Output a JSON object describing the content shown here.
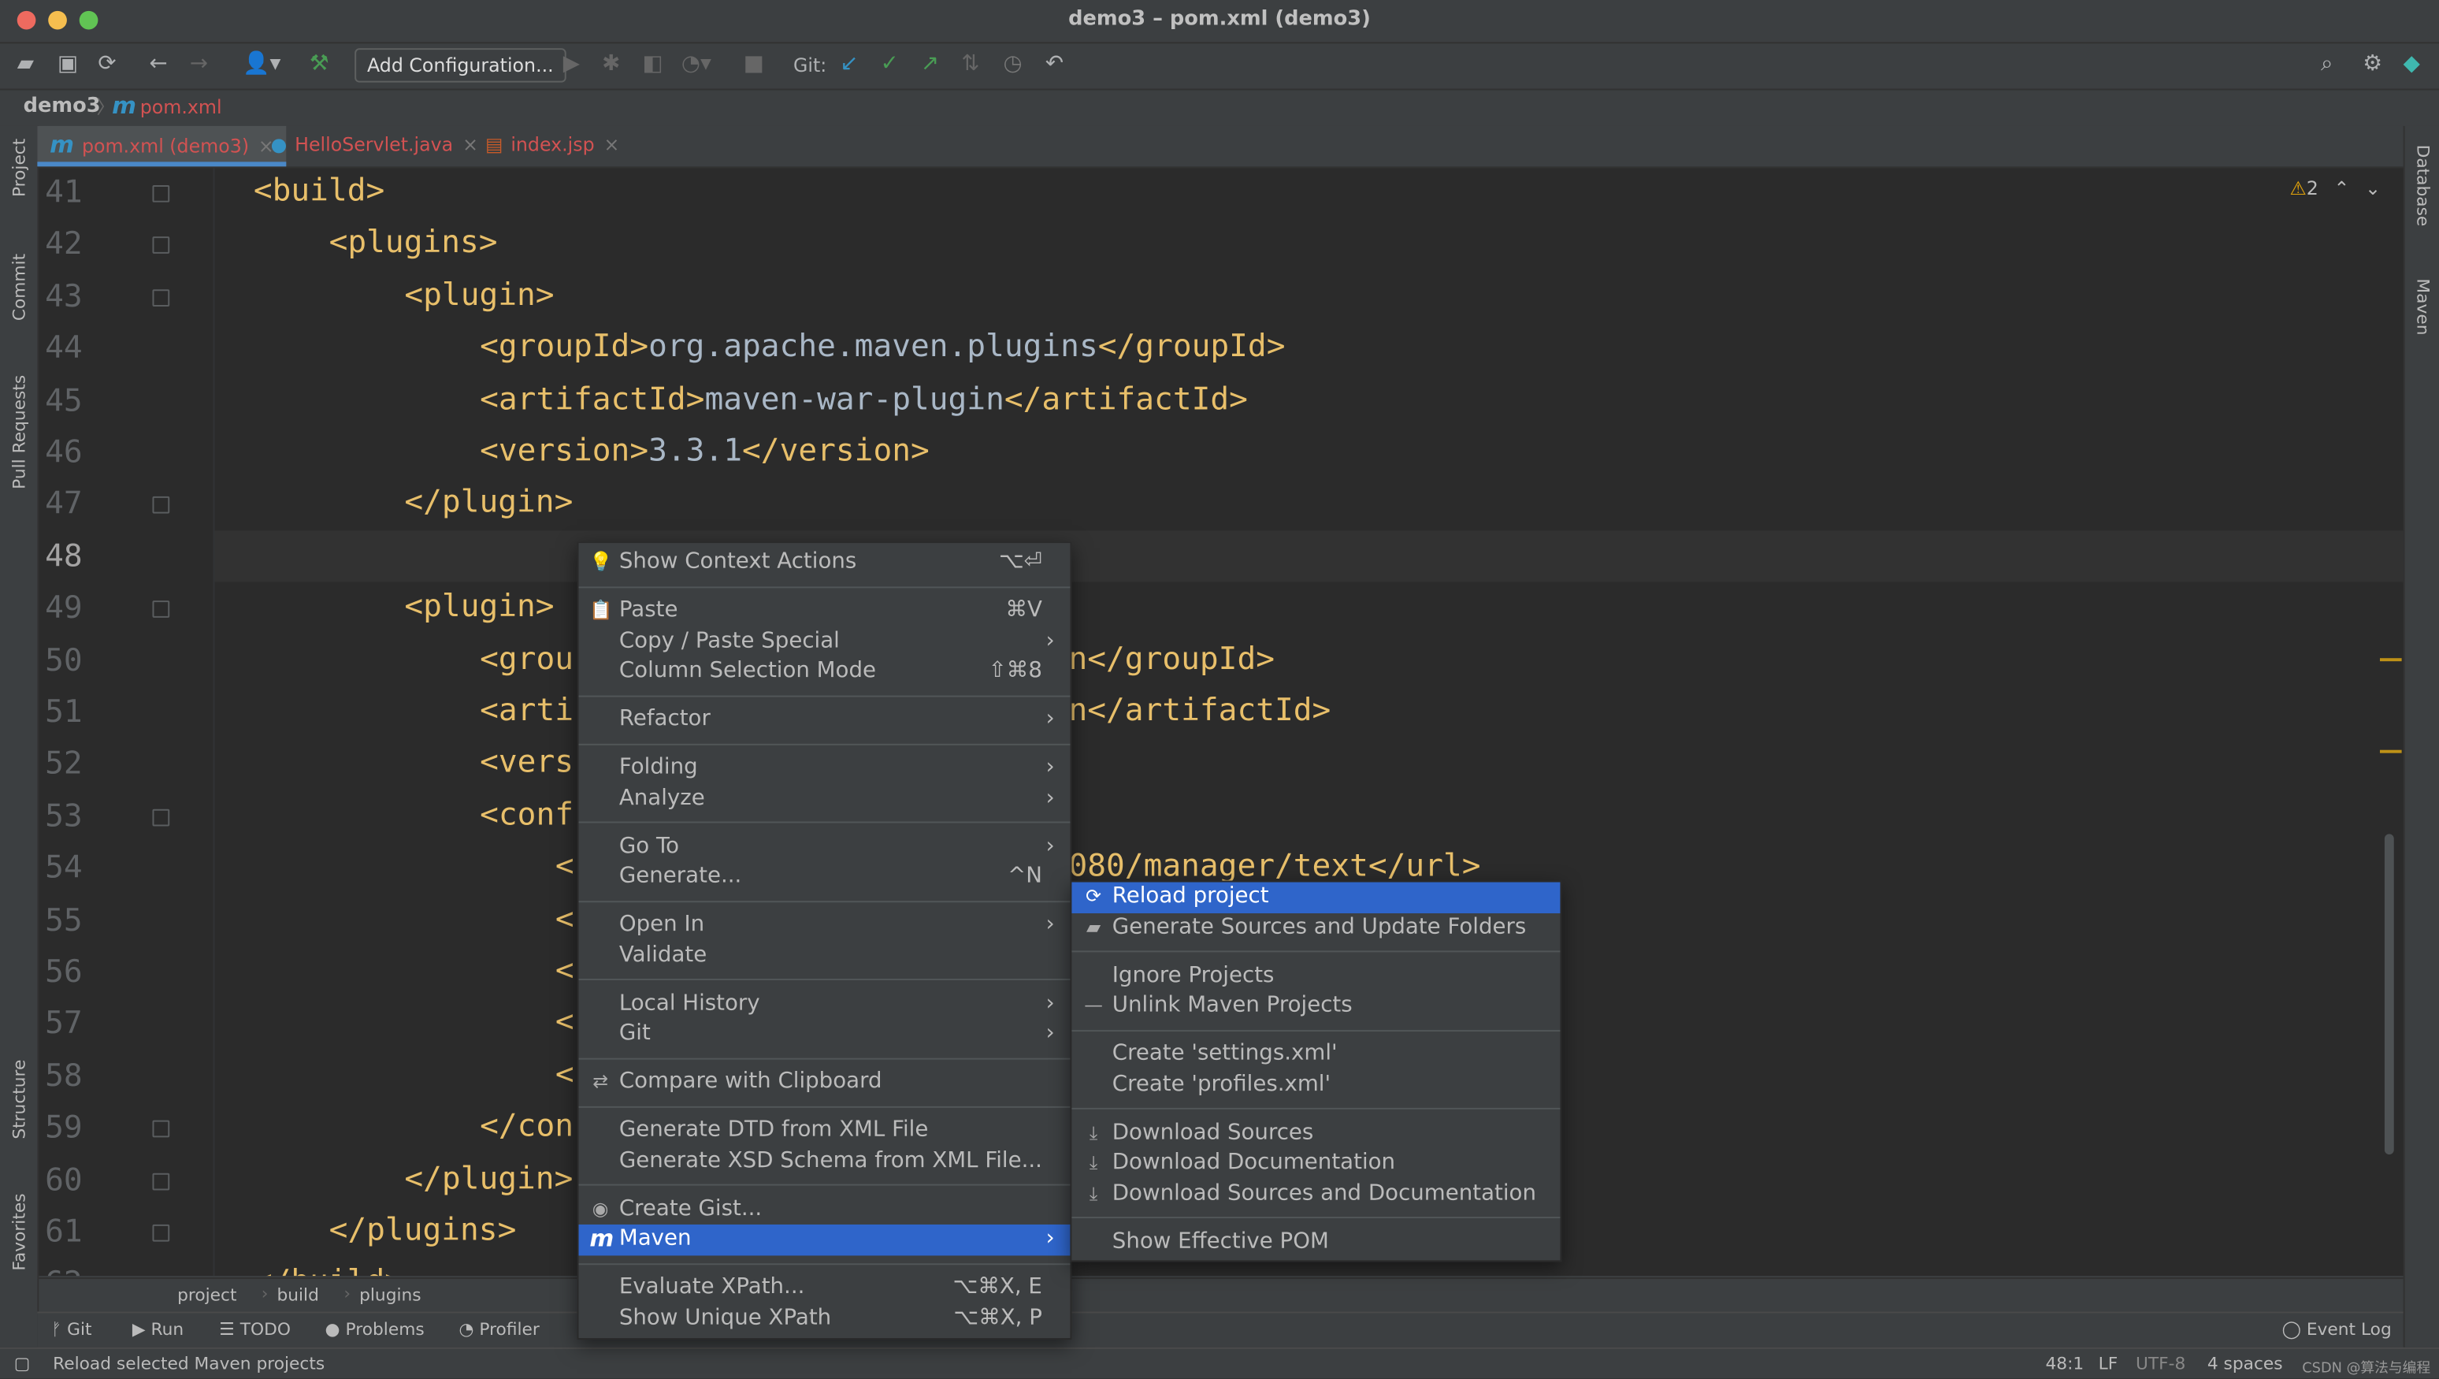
{
  "window": {
    "title": "demo3 – pom.xml (demo3)"
  },
  "toolbar": {
    "add_configuration": "Add Configuration...",
    "git_label": "Git:"
  },
  "breadcrumb": {
    "project": "demo3",
    "file": "pom.xml"
  },
  "tabs": [
    {
      "label": "pom.xml (demo3)",
      "icon": "maven-icon",
      "active": true
    },
    {
      "label": "HelloServlet.java",
      "icon": "java-class-icon"
    },
    {
      "label": "index.jsp",
      "icon": "jsp-icon"
    }
  ],
  "left_strip": [
    "Project",
    "Commit",
    "Pull Requests",
    "Structure",
    "Favorites"
  ],
  "right_strip": [
    "Database",
    "Maven"
  ],
  "inspection": {
    "warnings": "2"
  },
  "editor": {
    "current_line": "48",
    "lines": [
      {
        "n": "41",
        "indent": 0,
        "text": "<build>"
      },
      {
        "n": "42",
        "indent": 1,
        "text": "<plugins>"
      },
      {
        "n": "43",
        "indent": 2,
        "text": "<plugin>"
      },
      {
        "n": "44",
        "indent": 3,
        "text": "<groupId>",
        "val": "org.apache.maven.plugins",
        "end": "</groupId>"
      },
      {
        "n": "45",
        "indent": 3,
        "text": "<artifactId>",
        "val": "maven-war-plugin",
        "end": "</artifactId>"
      },
      {
        "n": "46",
        "indent": 3,
        "text": "<version>",
        "val": "3.3.1",
        "end": "</version>"
      },
      {
        "n": "47",
        "indent": 2,
        "text": "</plugin>"
      },
      {
        "n": "48",
        "indent": 2,
        "text": ""
      },
      {
        "n": "49",
        "indent": 2,
        "text": "<plugin>"
      },
      {
        "n": "50",
        "indent": 3,
        "text": "<grou",
        "right": "n</groupId>"
      },
      {
        "n": "51",
        "indent": 3,
        "text": "<arti",
        "right": "n</artifactId>"
      },
      {
        "n": "52",
        "indent": 3,
        "text": "<vers"
      },
      {
        "n": "53",
        "indent": 3,
        "text": "<conf"
      },
      {
        "n": "54",
        "indent": 4,
        "text": "<",
        "right": "080/manager/text</url>"
      },
      {
        "n": "55",
        "indent": 4,
        "text": "<"
      },
      {
        "n": "56",
        "indent": 4,
        "text": "<"
      },
      {
        "n": "57",
        "indent": 4,
        "text": "<"
      },
      {
        "n": "58",
        "indent": 4,
        "text": "<"
      },
      {
        "n": "59",
        "indent": 3,
        "text": "</con"
      },
      {
        "n": "60",
        "indent": 2,
        "text": "</plugin>"
      },
      {
        "n": "61",
        "indent": 1,
        "text": "</plugins>"
      },
      {
        "n": "62",
        "indent": 0,
        "text": "</build>"
      }
    ]
  },
  "editor_breadcrumb": [
    "project",
    "build",
    "plugins"
  ],
  "context_menu": [
    {
      "label": "Show Context Actions",
      "icon": "lightbulb-icon",
      "shortcut": "⌥⏎"
    },
    {
      "sep": true
    },
    {
      "label": "Paste",
      "icon": "clipboard-icon",
      "shortcut": "⌘V"
    },
    {
      "label": "Copy / Paste Special",
      "submenu": true
    },
    {
      "label": "Column Selection Mode",
      "shortcut": "⇧⌘8"
    },
    {
      "sep": true
    },
    {
      "label": "Refactor",
      "submenu": true
    },
    {
      "sep": true
    },
    {
      "label": "Folding",
      "submenu": true
    },
    {
      "label": "Analyze",
      "submenu": true
    },
    {
      "sep": true
    },
    {
      "label": "Go To",
      "submenu": true
    },
    {
      "label": "Generate...",
      "shortcut": "^N"
    },
    {
      "sep": true
    },
    {
      "label": "Open In",
      "submenu": true
    },
    {
      "label": "Validate"
    },
    {
      "sep": true
    },
    {
      "label": "Local History",
      "submenu": true
    },
    {
      "label": "Git",
      "submenu": true
    },
    {
      "sep": true
    },
    {
      "label": "Compare with Clipboard",
      "icon": "compare-icon"
    },
    {
      "sep": true
    },
    {
      "label": "Generate DTD from XML File"
    },
    {
      "label": "Generate XSD Schema from XML File..."
    },
    {
      "sep": true
    },
    {
      "label": "Create Gist...",
      "icon": "github-icon"
    },
    {
      "label": "Maven",
      "icon": "maven-icon",
      "submenu": true,
      "selected": true
    },
    {
      "sep": true
    },
    {
      "label": "Evaluate XPath...",
      "shortcut": "⌥⌘X, E"
    },
    {
      "label": "Show Unique XPath",
      "shortcut": "⌥⌘X, P"
    }
  ],
  "maven_submenu": [
    {
      "label": "Reload project",
      "icon": "reload-icon",
      "selected": true
    },
    {
      "label": "Generate Sources and Update Folders",
      "icon": "folder-gear-icon"
    },
    {
      "sep": true
    },
    {
      "label": "Ignore Projects"
    },
    {
      "label": "Unlink Maven Projects",
      "icon": "minus-icon"
    },
    {
      "sep": true
    },
    {
      "label": "Create 'settings.xml'"
    },
    {
      "label": "Create 'profiles.xml'"
    },
    {
      "sep": true
    },
    {
      "label": "Download Sources",
      "icon": "download-icon"
    },
    {
      "label": "Download Documentation",
      "icon": "download-icon"
    },
    {
      "label": "Download Sources and Documentation",
      "icon": "download-icon"
    },
    {
      "sep": true
    },
    {
      "label": "Show Effective POM"
    }
  ],
  "tool_windows": [
    {
      "label": "Git",
      "icon": "git-branch-icon"
    },
    {
      "label": "Run",
      "icon": "run-icon"
    },
    {
      "label": "TODO",
      "icon": "todo-icon"
    },
    {
      "label": "Problems",
      "icon": "problems-icon"
    },
    {
      "label": "Profiler",
      "icon": "profiler-icon"
    }
  ],
  "event_log": "Event Log",
  "status": {
    "message": "Reload selected Maven projects",
    "position": "48:1",
    "line_sep": "LF",
    "encoding": "UTF-8",
    "indent": "4 spaces",
    "watermark": "CSDN @算法与编程之美"
  },
  "colors": {
    "tag": "#e8bf6a",
    "text": "#a9b7c6",
    "selection": "#2f65ca",
    "error_tab": "#d25252",
    "editor_bg": "#2b2b2b"
  }
}
